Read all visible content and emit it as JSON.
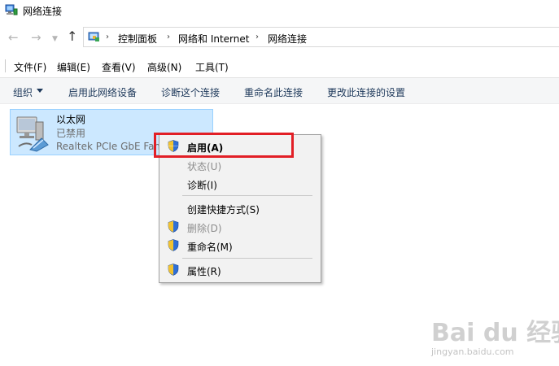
{
  "window": {
    "title": "网络连接"
  },
  "address": {
    "crumbs": [
      "控制面板",
      "网络和 Internet",
      "网络连接"
    ]
  },
  "menubar": {
    "items": [
      "文件(F)",
      "编辑(E)",
      "查看(V)",
      "高级(N)",
      "工具(T)"
    ]
  },
  "commandbar": {
    "organize": "组织",
    "items": [
      "启用此网络设备",
      "诊断这个连接",
      "重命名此连接",
      "更改此连接的设置"
    ]
  },
  "adapter": {
    "name": "以太网",
    "status": "已禁用",
    "device": "Realtek PCIe GbE Fam"
  },
  "context_menu": {
    "items": [
      {
        "label": "启用(A)",
        "icon": "shield-icon",
        "enabled": true,
        "bold": true
      },
      {
        "label": "状态(U)",
        "icon": "",
        "enabled": false
      },
      {
        "label": "诊断(I)",
        "icon": "",
        "enabled": true
      },
      {
        "label": "创建快捷方式(S)",
        "icon": "",
        "enabled": true
      },
      {
        "label": "删除(D)",
        "icon": "shield-icon",
        "enabled": false
      },
      {
        "label": "重命名(M)",
        "icon": "shield-icon",
        "enabled": true
      },
      {
        "label": "属性(R)",
        "icon": "shield-icon",
        "enabled": true
      }
    ]
  },
  "watermark": {
    "main": "Bai du 经验",
    "sub": "jingyan.baidu.com"
  },
  "colors": {
    "selection": "#cce8ff",
    "highlight_box": "#e21f26",
    "command_text": "#1e395b"
  }
}
